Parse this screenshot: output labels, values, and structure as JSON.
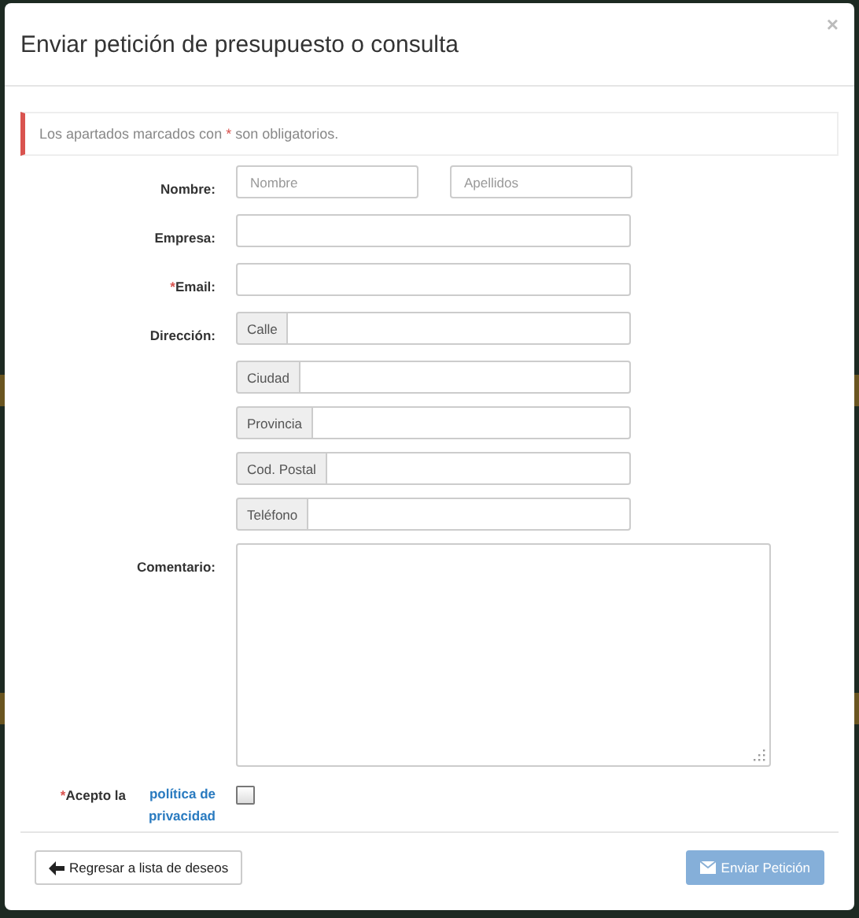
{
  "modal": {
    "title": "Enviar petición de presupuesto o consulta",
    "close": "×"
  },
  "notice": {
    "before": "Los apartados marcados con",
    "mark": "*",
    "after": "son obligatorios."
  },
  "rows": [
    {
      "kind": "pair",
      "label": "Nombre:",
      "inputs": [
        {
          "placeholder": "Nombre"
        },
        {
          "placeholder": "Apellidos"
        }
      ]
    },
    {
      "kind": "text",
      "label": "Empresa:"
    },
    {
      "kind": "text",
      "label": "Email:",
      "required_mark": "*"
    },
    {
      "kind": "addon",
      "label": "Dirección:",
      "addon": "Calle"
    },
    {
      "kind": "addon",
      "addon": "Ciudad"
    },
    {
      "kind": "addon",
      "addon": "Provincia"
    },
    {
      "kind": "addon",
      "addon": "Cod. Postal"
    },
    {
      "kind": "addon",
      "addon": "Teléfono"
    },
    {
      "kind": "textarea",
      "label": "Comentario:"
    }
  ],
  "consent": {
    "required_mark": "*",
    "label": "Acepto la",
    "link": "política de privacidad",
    "checked": false
  },
  "buttons": [
    {
      "kind": "back",
      "label": "Regresar a lista de deseos",
      "disabled": false
    },
    {
      "kind": "send",
      "label": "Enviar Petición",
      "disabled": true
    }
  ]
}
